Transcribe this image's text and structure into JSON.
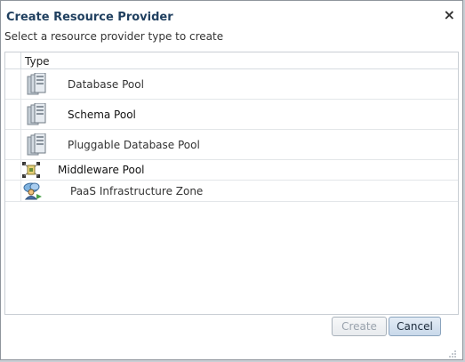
{
  "dialog": {
    "title": "Create Resource Provider",
    "close_glyph": "×",
    "subtitle": "Select a resource provider type to create"
  },
  "table": {
    "column_header": "Type",
    "rows": [
      {
        "label": "Database Pool",
        "icon": "database-pool-icon"
      },
      {
        "label": "Schema Pool",
        "icon": "schema-pool-icon"
      },
      {
        "label": "Pluggable Database Pool",
        "icon": "pluggable-database-pool-icon"
      },
      {
        "label": "Middleware Pool",
        "icon": "middleware-pool-icon"
      },
      {
        "label": "PaaS Infrastructure Zone",
        "icon": "paas-zone-icon"
      }
    ]
  },
  "buttons": {
    "create_label": "Create",
    "cancel_label": "Cancel"
  },
  "colors": {
    "title": "#1f3f5f",
    "cancel_bg": "#c9d9ea",
    "disabled_text": "#9aa3ad"
  }
}
